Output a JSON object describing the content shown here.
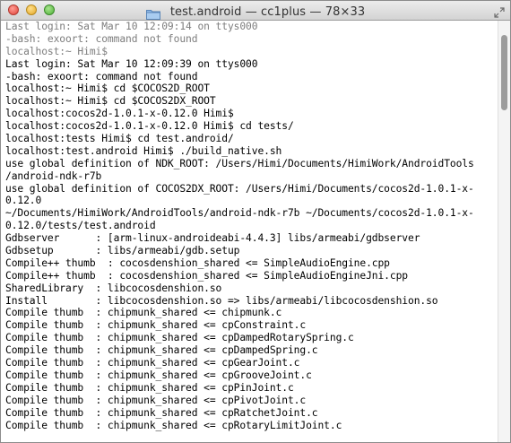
{
  "window": {
    "title": "test.android — cc1plus — 78×33"
  },
  "terminal": {
    "lines": [
      {
        "text": "Last login: Sat Mar 10 12:09:14 on ttys000",
        "dim": true
      },
      {
        "text": "-bash: exoort: command not found",
        "dim": true
      },
      {
        "text": "localhost:~ Himi$",
        "dim": true
      },
      {
        "text": "Last login: Sat Mar 10 12:09:39 on ttys000",
        "dim": false
      },
      {
        "text": "-bash: exoort: command not found",
        "dim": false
      },
      {
        "text": "localhost:~ Himi$ cd $COCOS2D_ROOT",
        "dim": false
      },
      {
        "text": "localhost:~ Himi$ cd $COCOS2DX_ROOT",
        "dim": false
      },
      {
        "text": "localhost:cocos2d-1.0.1-x-0.12.0 Himi$",
        "dim": false
      },
      {
        "text": "localhost:cocos2d-1.0.1-x-0.12.0 Himi$ cd tests/",
        "dim": false
      },
      {
        "text": "localhost:tests Himi$ cd test.android/",
        "dim": false
      },
      {
        "text": "localhost:test.android Himi$ ./build_native.sh",
        "dim": false
      },
      {
        "text": "use global definition of NDK_ROOT: /Users/Himi/Documents/HimiWork/AndroidTools",
        "dim": false
      },
      {
        "text": "/android-ndk-r7b",
        "dim": false
      },
      {
        "text": "use global definition of COCOS2DX_ROOT: /Users/Himi/Documents/cocos2d-1.0.1-x-",
        "dim": false
      },
      {
        "text": "0.12.0",
        "dim": false
      },
      {
        "text": "~/Documents/HimiWork/AndroidTools/android-ndk-r7b ~/Documents/cocos2d-1.0.1-x-",
        "dim": false
      },
      {
        "text": "0.12.0/tests/test.android",
        "dim": false
      },
      {
        "text": "Gdbserver      : [arm-linux-androideabi-4.4.3] libs/armeabi/gdbserver",
        "dim": false
      },
      {
        "text": "Gdbsetup       : libs/armeabi/gdb.setup",
        "dim": false
      },
      {
        "text": "Compile++ thumb  : cocosdenshion_shared <= SimpleAudioEngine.cpp",
        "dim": false
      },
      {
        "text": "Compile++ thumb  : cocosdenshion_shared <= SimpleAudioEngineJni.cpp",
        "dim": false
      },
      {
        "text": "SharedLibrary  : libcocosdenshion.so",
        "dim": false
      },
      {
        "text": "Install        : libcocosdenshion.so => libs/armeabi/libcocosdenshion.so",
        "dim": false
      },
      {
        "text": "Compile thumb  : chipmunk_shared <= chipmunk.c",
        "dim": false
      },
      {
        "text": "Compile thumb  : chipmunk_shared <= cpConstraint.c",
        "dim": false
      },
      {
        "text": "Compile thumb  : chipmunk_shared <= cpDampedRotarySpring.c",
        "dim": false
      },
      {
        "text": "Compile thumb  : chipmunk_shared <= cpDampedSpring.c",
        "dim": false
      },
      {
        "text": "Compile thumb  : chipmunk_shared <= cpGearJoint.c",
        "dim": false
      },
      {
        "text": "Compile thumb  : chipmunk_shared <= cpGrooveJoint.c",
        "dim": false
      },
      {
        "text": "Compile thumb  : chipmunk_shared <= cpPinJoint.c",
        "dim": false
      },
      {
        "text": "Compile thumb  : chipmunk_shared <= cpPivotJoint.c",
        "dim": false
      },
      {
        "text": "Compile thumb  : chipmunk_shared <= cpRatchetJoint.c",
        "dim": false
      },
      {
        "text": "Compile thumb  : chipmunk_shared <= cpRotaryLimitJoint.c",
        "dim": false
      }
    ]
  },
  "icons": {
    "title_icon": "folder-icon",
    "fullscreen": "fullscreen-icon"
  },
  "colors": {
    "terminal_bg": "#ffffff",
    "text": "#000000",
    "dim_text": "#7d7d7d",
    "close": "#e0443a",
    "minimize": "#e3a628",
    "zoom": "#4fb139"
  }
}
